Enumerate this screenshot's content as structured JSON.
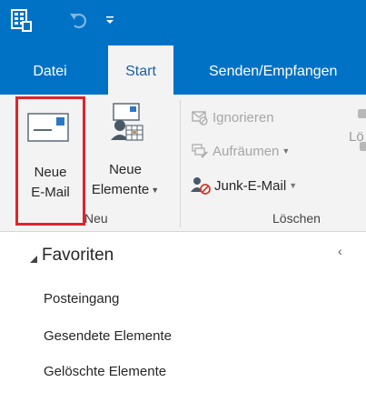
{
  "quick_access": {
    "app_icon": "outlook-app-icon",
    "undo_icon": "undo-icon",
    "customize_icon": "qat-dropdown-icon"
  },
  "tabs": [
    {
      "label": "Datei",
      "active": false
    },
    {
      "label": "Start",
      "active": true
    },
    {
      "label": "Senden/Empfangen",
      "active": false
    }
  ],
  "ribbon": {
    "new_group": {
      "new_mail": {
        "line1": "Neue",
        "line2": "E-Mail",
        "icon": "envelope-icon"
      },
      "new_items": {
        "line1": "Neue",
        "line2": "Elemente",
        "icon": "new-items-icon",
        "has_dropdown": true
      },
      "label": "Neu"
    },
    "delete_group": {
      "ignore": {
        "label": "Ignorieren",
        "enabled": false,
        "icon": "ignore-icon"
      },
      "cleanup": {
        "label": "Aufräumen",
        "enabled": false,
        "has_dropdown": true,
        "icon": "cleanup-icon"
      },
      "junk": {
        "label": "Junk-E-Mail",
        "enabled": true,
        "has_dropdown": true,
        "icon": "junk-icon"
      },
      "clipped": "Lö",
      "label": "Löschen"
    }
  },
  "colors": {
    "title_bar": "#0072c6",
    "ribbon_bg": "#f3f3f3",
    "highlight_border": "#e0232b",
    "active_tab_text": "#1f5fa8"
  },
  "folder_pane": {
    "favorites_label": "Favoriten",
    "collapse_icon": "chevron-left-icon",
    "folders": [
      "Posteingang",
      "Gesendete Elemente",
      "Gelöschte Elemente"
    ]
  }
}
